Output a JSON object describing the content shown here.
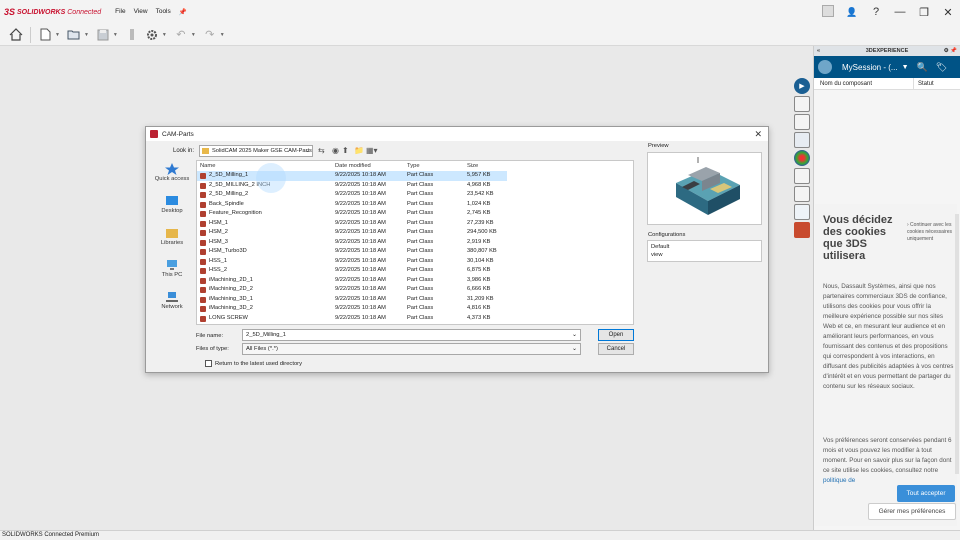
{
  "app": {
    "brand_ds": "3S",
    "brand": "SOLIDWORKS",
    "brand_suffix": "Connected"
  },
  "menu": [
    "File",
    "View",
    "Tools"
  ],
  "status_bar": "SOLIDWORKS Connected Premium",
  "task_pane": {
    "header": "3DEXPERIENCE",
    "session_title": "MySession - (...",
    "columns": [
      "Nom du composant",
      "Statut"
    ]
  },
  "cookie": {
    "title": "Vous décidez des cookies que 3DS utilisera",
    "continue": "› Continuer avec les cookies nécessaires uniquement",
    "body1": "Nous, Dassault Systèmes, ainsi que nos partenaires commerciaux 3DS de confiance, utilisons des cookies pour vous offrir la meilleure expérience possible sur nos sites Web et ce, en mesurant leur audience et en améliorant leurs performances, en vous fournissant des contenus et des propositions qui correspondent à vos interactions, en diffusant des publicités adaptées à vos centres d'intérêt et en vous permettant de partager du contenu sur les réseaux sociaux.",
    "body2": "Vos préférences seront conservées pendant 6 mois et vous pouvez les modifier à tout moment. Pour en savoir plus sur la façon dont ce site utilise les cookies, consultez notre",
    "link": "politique de",
    "accept": "Tout accepter",
    "prefs": "Gérer mes préférences"
  },
  "dialog": {
    "title": "CAM-Parts",
    "look_in_label": "Look in:",
    "look_in_value": "SolidCAM 2025 Maker GSE CAM-Parts",
    "places": [
      "Quick access",
      "Desktop",
      "Libraries",
      "This PC",
      "Network"
    ],
    "columns": [
      "Name",
      "Date modified",
      "Type",
      "Size"
    ],
    "files": [
      {
        "name": "2_5D_Milling_1",
        "date": "9/22/2025 10:18 AM",
        "type": "Part Class",
        "size": "5,957 KB",
        "selected": true
      },
      {
        "name": "2_5D_MILLING_2 INCH",
        "date": "9/22/2025 10:18 AM",
        "type": "Part Class",
        "size": "4,968 KB"
      },
      {
        "name": "2_5D_Milling_2",
        "date": "9/22/2025 10:18 AM",
        "type": "Part Class",
        "size": "23,542 KB"
      },
      {
        "name": "Back_Spindle",
        "date": "9/22/2025 10:18 AM",
        "type": "Part Class",
        "size": "1,024 KB"
      },
      {
        "name": "Feature_Recognition",
        "date": "9/22/2025 10:18 AM",
        "type": "Part Class",
        "size": "2,745 KB"
      },
      {
        "name": "HSM_1",
        "date": "9/22/2025 10:18 AM",
        "type": "Part Class",
        "size": "27,239 KB"
      },
      {
        "name": "HSM_2",
        "date": "9/22/2025 10:18 AM",
        "type": "Part Class",
        "size": "294,500 KB"
      },
      {
        "name": "HSM_3",
        "date": "9/22/2025 10:18 AM",
        "type": "Part Class",
        "size": "2,919 KB"
      },
      {
        "name": "HSM_Turbo3D",
        "date": "9/22/2025 10:18 AM",
        "type": "Part Class",
        "size": "380,807 KB"
      },
      {
        "name": "HSS_1",
        "date": "9/22/2025 10:18 AM",
        "type": "Part Class",
        "size": "30,104 KB"
      },
      {
        "name": "HSS_2",
        "date": "9/22/2025 10:18 AM",
        "type": "Part Class",
        "size": "6,875 KB"
      },
      {
        "name": "iMachining_2D_1",
        "date": "9/22/2025 10:18 AM",
        "type": "Part Class",
        "size": "3,986 KB"
      },
      {
        "name": "iMachining_2D_2",
        "date": "9/22/2025 10:18 AM",
        "type": "Part Class",
        "size": "6,666 KB"
      },
      {
        "name": "iMachining_3D_1",
        "date": "9/22/2025 10:18 AM",
        "type": "Part Class",
        "size": "31,209 KB"
      },
      {
        "name": "iMachining_3D_2",
        "date": "9/22/2025 10:18 AM",
        "type": "Part Class",
        "size": "4,816 KB"
      },
      {
        "name": "LONG SCREW",
        "date": "9/22/2025 10:18 AM",
        "type": "Part Class",
        "size": "4,373 KB"
      }
    ],
    "file_name_label": "File name:",
    "file_name_value": "2_5D_Milling_1",
    "file_type_label": "Files of type:",
    "file_type_value": "All Files (*.*)",
    "open": "Open",
    "cancel": "Cancel",
    "checkbox": "Return to the latest used directory",
    "preview_label": "Preview",
    "configurations_label": "Configurations",
    "configurations": [
      "Default",
      "view"
    ]
  }
}
